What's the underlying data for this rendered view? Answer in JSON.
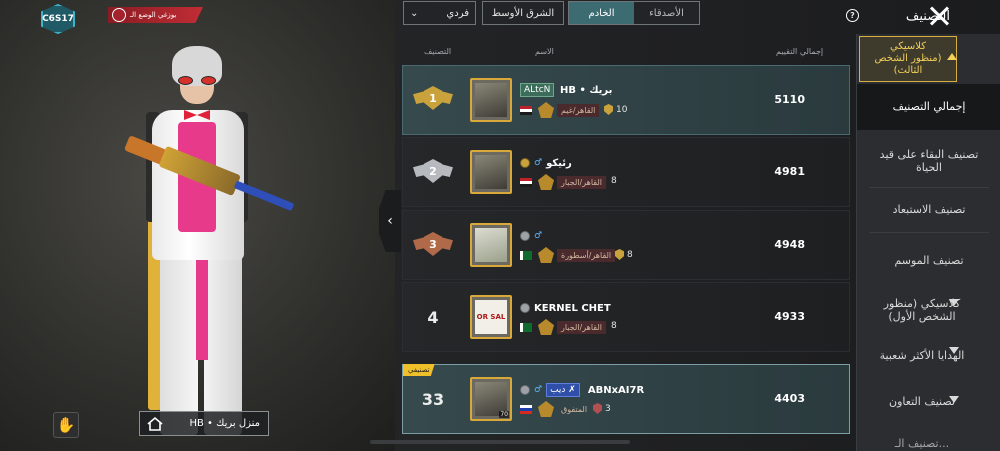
{
  "season_badge": "C6S17",
  "mode_banner": "بوزغي الوضع الـ",
  "top_bar": {
    "solo_select": "فردي",
    "region": "الشرق الأوسط",
    "tabs": [
      {
        "label": "الخادم",
        "active": true
      },
      {
        "label": "الأصدقاء",
        "active": false
      }
    ],
    "title": "التصنيف"
  },
  "columns": {
    "rating": "إجمالي التقييم",
    "name": "الاسم",
    "rank": "التصنيف"
  },
  "rows": [
    {
      "rank": "1",
      "medal": "gold",
      "clan": "ALtcN",
      "name": "HB • بريك",
      "flag": "eg",
      "tier": "القاهر/غيم",
      "shields": "10",
      "rating": "5110",
      "avatar_level": ""
    },
    {
      "rank": "2",
      "medal": "silver",
      "clan": "",
      "name": "رئيكو",
      "flag": "eg",
      "tier": "القاهر/الجبار",
      "shields": "8",
      "rating": "4981",
      "avatar_level": ""
    },
    {
      "rank": "3",
      "medal": "bronze",
      "clan": "",
      "name": "",
      "flag": "pk",
      "tier": "القاهر/أسطورة",
      "shields": "8",
      "rating": "4948",
      "avatar_level": ""
    },
    {
      "rank": "4",
      "medal": "",
      "clan": "",
      "name": "KERNEL CHET",
      "flag": "pk",
      "tier": "القاهر/الجبار",
      "shields": "8",
      "rating": "4933",
      "avatar_level": "",
      "avatar_text": "OR SAL"
    },
    {
      "rank": "33",
      "medal": "",
      "clan": "ديب ✗",
      "name": "ABNxAI7R",
      "flag": "ru",
      "tier": "المتفوق",
      "shields": "3",
      "rating": "4403",
      "avatar_level": "70",
      "you_tag": "تصنيفي"
    }
  ],
  "sidebar": {
    "top_category": "كلاسيكي (منظور الشخص الثالث)",
    "items": [
      "إجمالي التصنيف",
      "تصنيف البقاء على قيد الحياة",
      "تصنيف الاستبعاد",
      "تصنيف الموسم"
    ],
    "categories": [
      "كلاسيكي (منظور الشخص الأول)",
      "الهدايا الأكثر شعبية",
      "تصنيف التعاون",
      "تصنيف الـ..."
    ]
  },
  "home_label": "HB • منزل بريك",
  "icons": [
    "close-icon",
    "help-icon",
    "home-icon",
    "emote-icon",
    "chevron-down-icon",
    "chevron-left-icon"
  ],
  "colors": {
    "accent": "#3d6b72",
    "gold": "#d8a838",
    "highlight": "#f0c02a"
  }
}
